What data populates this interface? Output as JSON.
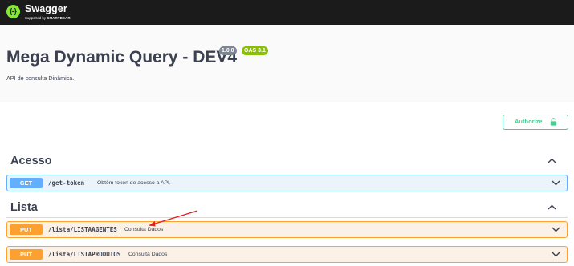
{
  "topbar": {
    "logo_text": "Swagger",
    "logo_sub_prefix": "Supported by",
    "logo_sub_brand": "SMARTBEAR",
    "logo_icon": "swagger-logo-icon"
  },
  "info": {
    "title": "Mega Dynamic Query - DEV4",
    "version_badge": "1.0.0",
    "oas_badge": "OAS 3.1",
    "description": "API de consulta Dinâmica."
  },
  "auth": {
    "authorize_label": "Authorize",
    "icon": "unlock-icon"
  },
  "tags": [
    {
      "name": "Acesso",
      "operations": [
        {
          "method": "GET",
          "path": "/get-token",
          "summary": "Obtêm token de acesso a API."
        }
      ]
    },
    {
      "name": "Lista",
      "operations": [
        {
          "method": "PUT",
          "path": "/lista/LISTAAGENTES",
          "summary": "Consulta Dados"
        },
        {
          "method": "PUT",
          "path": "/lista/LISTAPRODUTOS",
          "summary": "Consulta Dados"
        }
      ]
    }
  ],
  "colors": {
    "topbar": "#1b1b1b",
    "brand_green": "#85ea2d",
    "get": "#61affe",
    "put": "#fca130",
    "authorize": "#49cc90",
    "annotation_arrow": "#e02020"
  }
}
